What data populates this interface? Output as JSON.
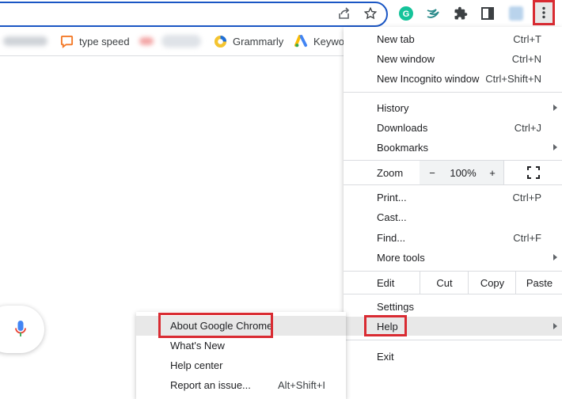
{
  "toolbar": {
    "icons": [
      "share-icon",
      "star-icon",
      "grammarly-icon",
      "extension-swift-icon",
      "puzzle-icon",
      "sidepanel-icon",
      "profile-icon",
      "more-vert-icon"
    ]
  },
  "bookmarks": [
    {
      "label": "type speed",
      "icon": "chat-bubble-icon"
    },
    {
      "label": "Grammarly",
      "icon": "grammarly-icon"
    },
    {
      "label": "Keywo",
      "icon": "google-ads-icon"
    }
  ],
  "menu": {
    "new_tab": {
      "label": "New tab",
      "shortcut": "Ctrl+T"
    },
    "new_window": {
      "label": "New window",
      "shortcut": "Ctrl+N"
    },
    "incognito": {
      "label": "New Incognito window",
      "shortcut": "Ctrl+Shift+N"
    },
    "history": {
      "label": "History"
    },
    "downloads": {
      "label": "Downloads",
      "shortcut": "Ctrl+J"
    },
    "bookmarks": {
      "label": "Bookmarks"
    },
    "zoom": {
      "label": "Zoom",
      "minus": "−",
      "value": "100%",
      "plus": "+"
    },
    "print": {
      "label": "Print...",
      "shortcut": "Ctrl+P"
    },
    "cast": {
      "label": "Cast..."
    },
    "find": {
      "label": "Find...",
      "shortcut": "Ctrl+F"
    },
    "more_tools": {
      "label": "More tools"
    },
    "edit": {
      "label": "Edit",
      "cut": "Cut",
      "copy": "Copy",
      "paste": "Paste"
    },
    "settings": {
      "label": "Settings"
    },
    "help": {
      "label": "Help"
    },
    "exit": {
      "label": "Exit"
    }
  },
  "help_submenu": {
    "about": {
      "label": "About Google Chrome"
    },
    "whats_new": {
      "label": "What's New"
    },
    "help_center": {
      "label": "Help center"
    },
    "report": {
      "label": "Report an issue...",
      "shortcut": "Alt+Shift+I"
    }
  },
  "colors": {
    "highlight": "#d92b32",
    "accent": "#1a56c4",
    "hover": "#e8e8e8"
  }
}
